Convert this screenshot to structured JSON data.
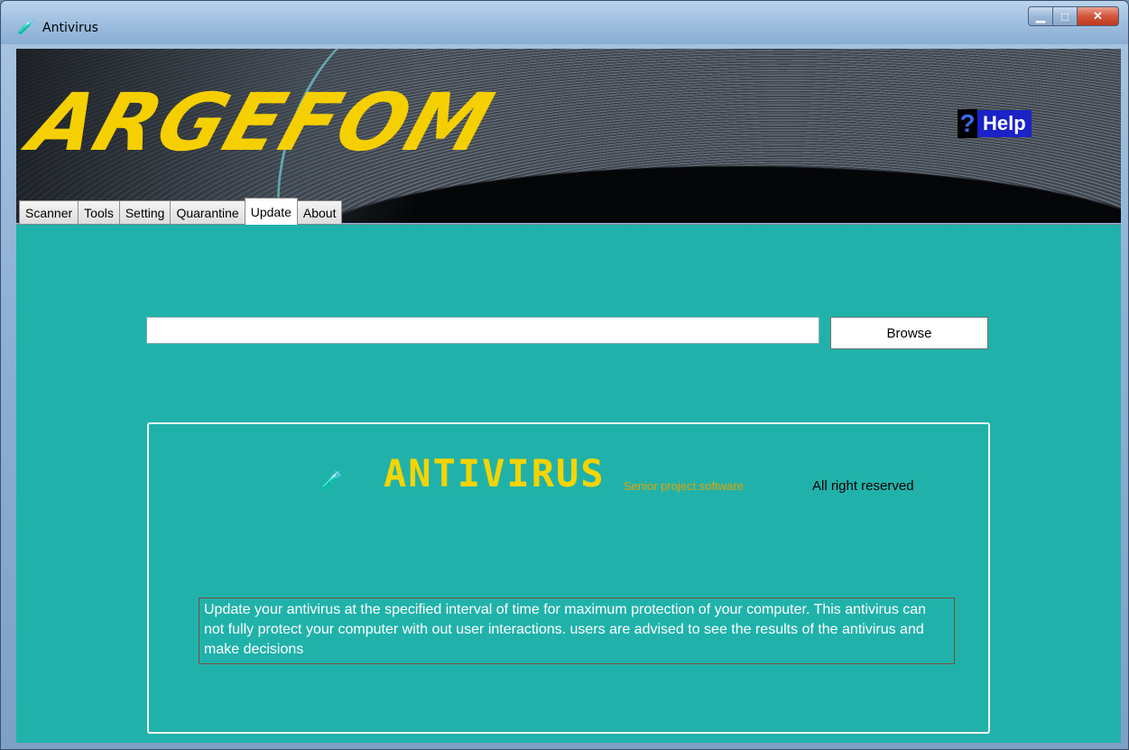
{
  "window": {
    "title": "Antivirus",
    "icon": "antivirus-app-icon"
  },
  "banner": {
    "logo_text": "ARGEFOM",
    "help_label": "Help",
    "help_symbol": "?"
  },
  "tabs": [
    {
      "label": "Scanner",
      "active": false
    },
    {
      "label": "Tools",
      "active": false
    },
    {
      "label": "Setting",
      "active": false
    },
    {
      "label": "Quarantine",
      "active": false
    },
    {
      "label": "Update",
      "active": true
    },
    {
      "label": "About",
      "active": false
    }
  ],
  "update": {
    "path_value": "",
    "browse_label": "Browse"
  },
  "about": {
    "brand": "ANTIVIRUS",
    "tagline": "Senior project software",
    "rights": "All right reserved",
    "info_text": "Update your antivirus at the specified interval of time for maximum protection of your computer. This antivirus can not fully protect your computer with out user interactions. users are advised to see the results of the antivirus and make decisions"
  },
  "colors": {
    "content_bg": "#20b2aa",
    "logo": "#f5cf00",
    "brand": "#f5d400",
    "tagline": "#e6a200"
  }
}
